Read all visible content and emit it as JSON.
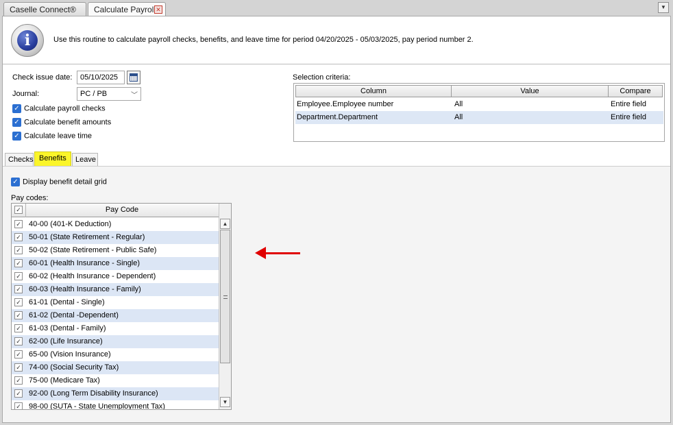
{
  "window_tabs": [
    {
      "label": "Caselle Connect®",
      "active": false
    },
    {
      "label": "Calculate Payroll",
      "active": true
    }
  ],
  "info": {
    "icon": "info-icon",
    "text": "Use this routine to calculate payroll checks, benefits, and leave time for period 04/20/2025 - 05/03/2025, pay period number 2."
  },
  "form": {
    "check_issue_date_label": "Check issue date:",
    "check_issue_date_value": "05/10/2025",
    "journal_label": "Journal:",
    "journal_value": "PC / PB",
    "options": [
      {
        "label": "Calculate payroll checks",
        "checked": true
      },
      {
        "label": "Calculate benefit amounts",
        "checked": true
      },
      {
        "label": "Calculate leave time",
        "checked": true
      }
    ]
  },
  "selection_criteria": {
    "label": "Selection criteria:",
    "columns": [
      "Column",
      "Value",
      "Compare"
    ],
    "rows": [
      [
        "Employee.Employee number",
        "All",
        "Entire field"
      ],
      [
        "Department.Department",
        "All",
        "Entire field"
      ]
    ]
  },
  "tabs": [
    {
      "label": "Checks",
      "active": false
    },
    {
      "label": "Benefits",
      "active": true
    },
    {
      "label": "Leave",
      "active": false
    }
  ],
  "benefits": {
    "display_grid_label": "Display benefit detail grid",
    "display_grid_checked": true,
    "pay_codes_label": "Pay codes:",
    "column_header": "Pay Code",
    "rows": [
      "40-00 (401-K Deduction)",
      "50-01 (State Retirement - Regular)",
      "50-02 (State Retirement - Public Safe)",
      "60-01 (Health Insurance - Single)",
      "60-02 (Health Insurance - Dependent)",
      "60-03 (Health Insurance - Family)",
      "61-01 (Dental - Single)",
      "61-02 (Dental -Dependent)",
      "61-03 (Dental - Family)",
      "62-00 (Life Insurance)",
      "65-00 (Vision Insurance)",
      "74-00 (Social Security Tax)",
      "75-00 (Medicare Tax)",
      "92-00 (Long Term Disability Insurance)",
      "98-00 (SUTA - State Unemployment Tax)"
    ]
  },
  "colors": {
    "highlight_tab": "#fbf52a",
    "alt_row": "#dce6f5",
    "check_blue": "#2b6fd1",
    "annotation_arrow": "#e00000"
  }
}
